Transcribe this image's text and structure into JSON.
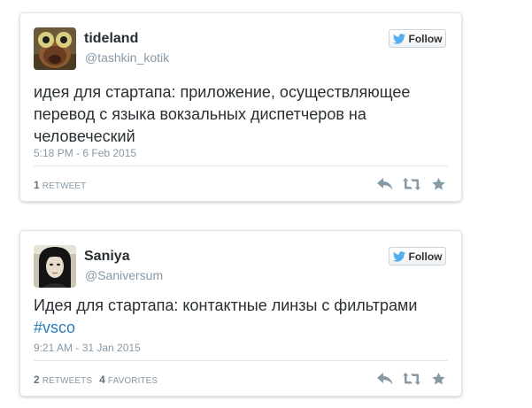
{
  "colors": {
    "accent": "#55acee",
    "link": "#2b7bb9",
    "secondary_text": "#8899a6",
    "primary_text": "#292f33",
    "action_icon": "#8899a6"
  },
  "tweets": [
    {
      "display_name": "tideland",
      "screen_name": "@tashkin_kotik",
      "follow_label": "Follow",
      "text": "идея для стартапа: приложение, осуществляющее перевод с языка вокзальных диспетчеров на человеческий",
      "hashtag": "",
      "timestamp": "5:18 PM - 6 Feb 2015",
      "stats": [
        {
          "count": "1",
          "label": "RETWEET"
        }
      ],
      "actions": [
        "reply-icon",
        "retweet-icon",
        "favorite-icon"
      ]
    },
    {
      "display_name": "Saniya",
      "screen_name": "@Saniversum",
      "follow_label": "Follow",
      "text": "Идея для стартапа: контактные линзы с фильтрами",
      "hashtag": "#vsco",
      "timestamp": "9:21 AM - 31 Jan 2015",
      "stats": [
        {
          "count": "2",
          "label": "RETWEETS"
        },
        {
          "count": "4",
          "label": "FAVORITES"
        }
      ],
      "actions": [
        "reply-icon",
        "retweet-icon",
        "favorite-icon"
      ]
    }
  ]
}
